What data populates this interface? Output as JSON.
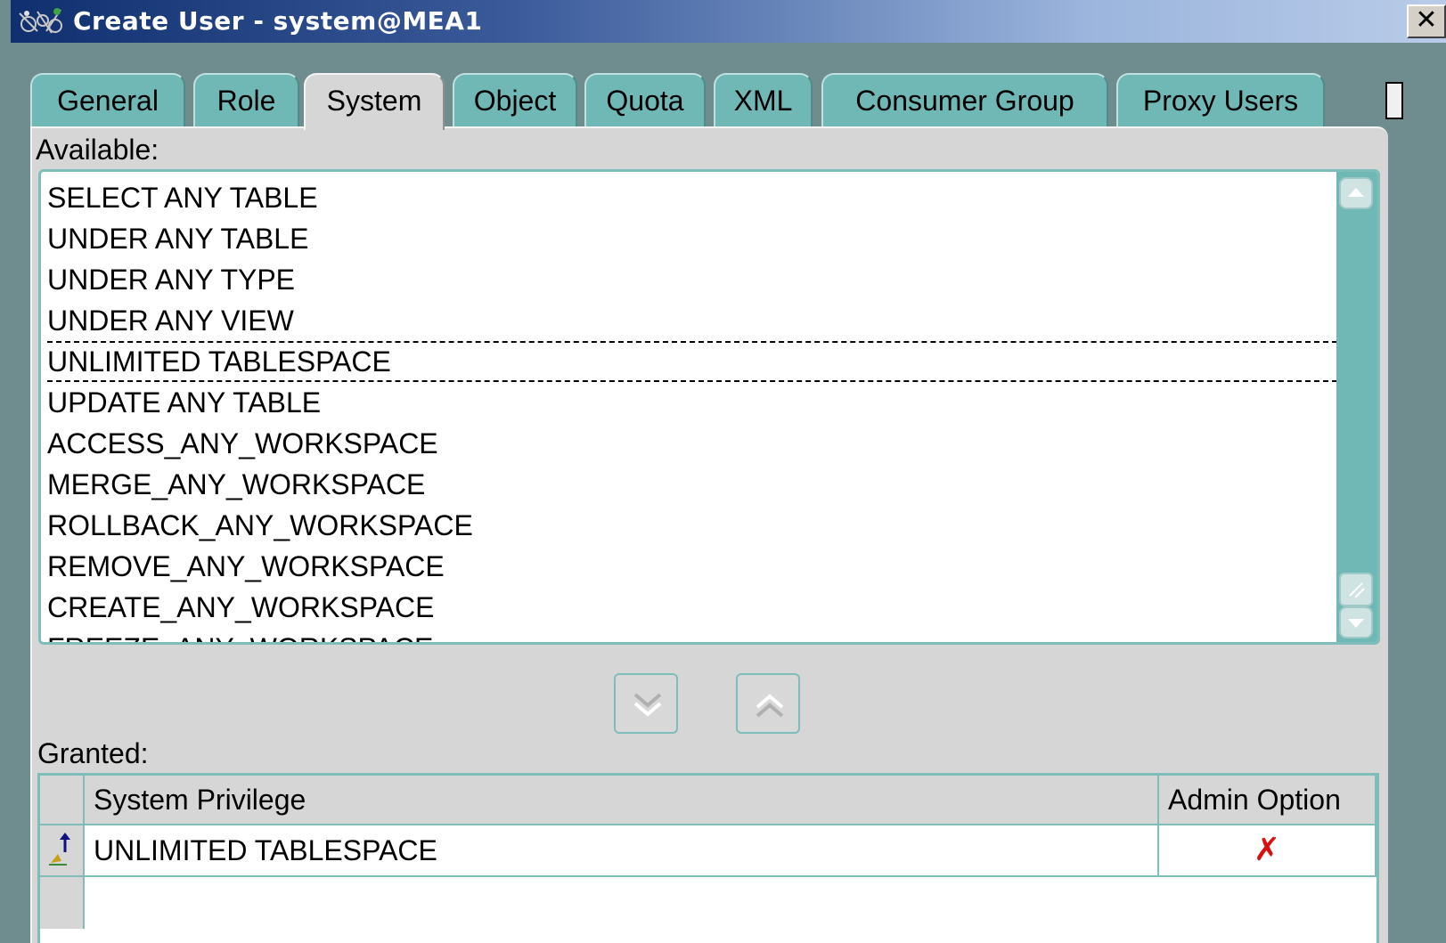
{
  "window": {
    "title": "Create User - system@MEA1",
    "close_glyph": "✕"
  },
  "tabs": [
    {
      "label": "General",
      "active": false
    },
    {
      "label": "Role",
      "active": false
    },
    {
      "label": "System",
      "active": true
    },
    {
      "label": "Object",
      "active": false
    },
    {
      "label": "Quota",
      "active": false
    },
    {
      "label": "XML",
      "active": false
    },
    {
      "label": "Consumer Group",
      "active": false
    },
    {
      "label": "Proxy Users",
      "active": false
    }
  ],
  "available": {
    "label": "Available:",
    "items": [
      "SELECT ANY TABLE",
      "UNDER ANY TABLE",
      "UNDER ANY TYPE",
      "UNDER ANY VIEW",
      "UNLIMITED TABLESPACE",
      "UPDATE ANY TABLE",
      "ACCESS_ANY_WORKSPACE",
      "MERGE_ANY_WORKSPACE",
      "ROLLBACK_ANY_WORKSPACE",
      "REMOVE_ANY_WORKSPACE",
      "CREATE_ANY_WORKSPACE",
      "FREEZE_ANY_WORKSPACE"
    ],
    "focused_item": "UNLIMITED TABLESPACE"
  },
  "move_buttons": {
    "down_icon": "chevron-double-down-icon",
    "up_icon": "chevron-double-up-icon"
  },
  "granted": {
    "label": "Granted:",
    "columns": [
      "System Privilege",
      "Admin Option"
    ],
    "rows": [
      {
        "privilege": "UNLIMITED TABLESPACE",
        "admin_option": "✗"
      }
    ]
  },
  "colors": {
    "tab_inactive": "#70b8b6",
    "tab_active": "#d6d6d6",
    "border_teal": "#7fbdbb",
    "admin_x": "#d81010"
  }
}
